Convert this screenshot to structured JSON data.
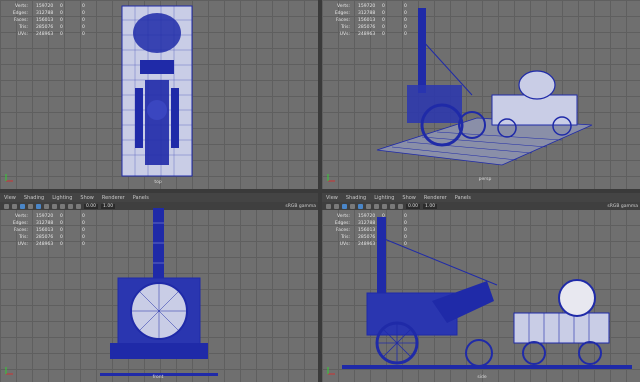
{
  "menu": [
    "View",
    "Shading",
    "Lighting",
    "Show",
    "Renderer",
    "Panels"
  ],
  "stat_labels": [
    "Verts:",
    "Edges:",
    "Faces:",
    "Tris:",
    "UVs:"
  ],
  "stat_values": [
    "159720",
    "312788",
    "156013",
    "285076",
    "248963"
  ],
  "stat_zero": "0",
  "toolbar": {
    "field_a": "0.00",
    "field_b": "1.00",
    "colorspace": "sRGB gamma"
  },
  "viewports": [
    {
      "camera": "top"
    },
    {
      "camera": "persp"
    },
    {
      "camera": "front"
    },
    {
      "camera": "side"
    }
  ],
  "colors": {
    "wire": "#1f2aa8",
    "grid": "#6f6f6f"
  }
}
